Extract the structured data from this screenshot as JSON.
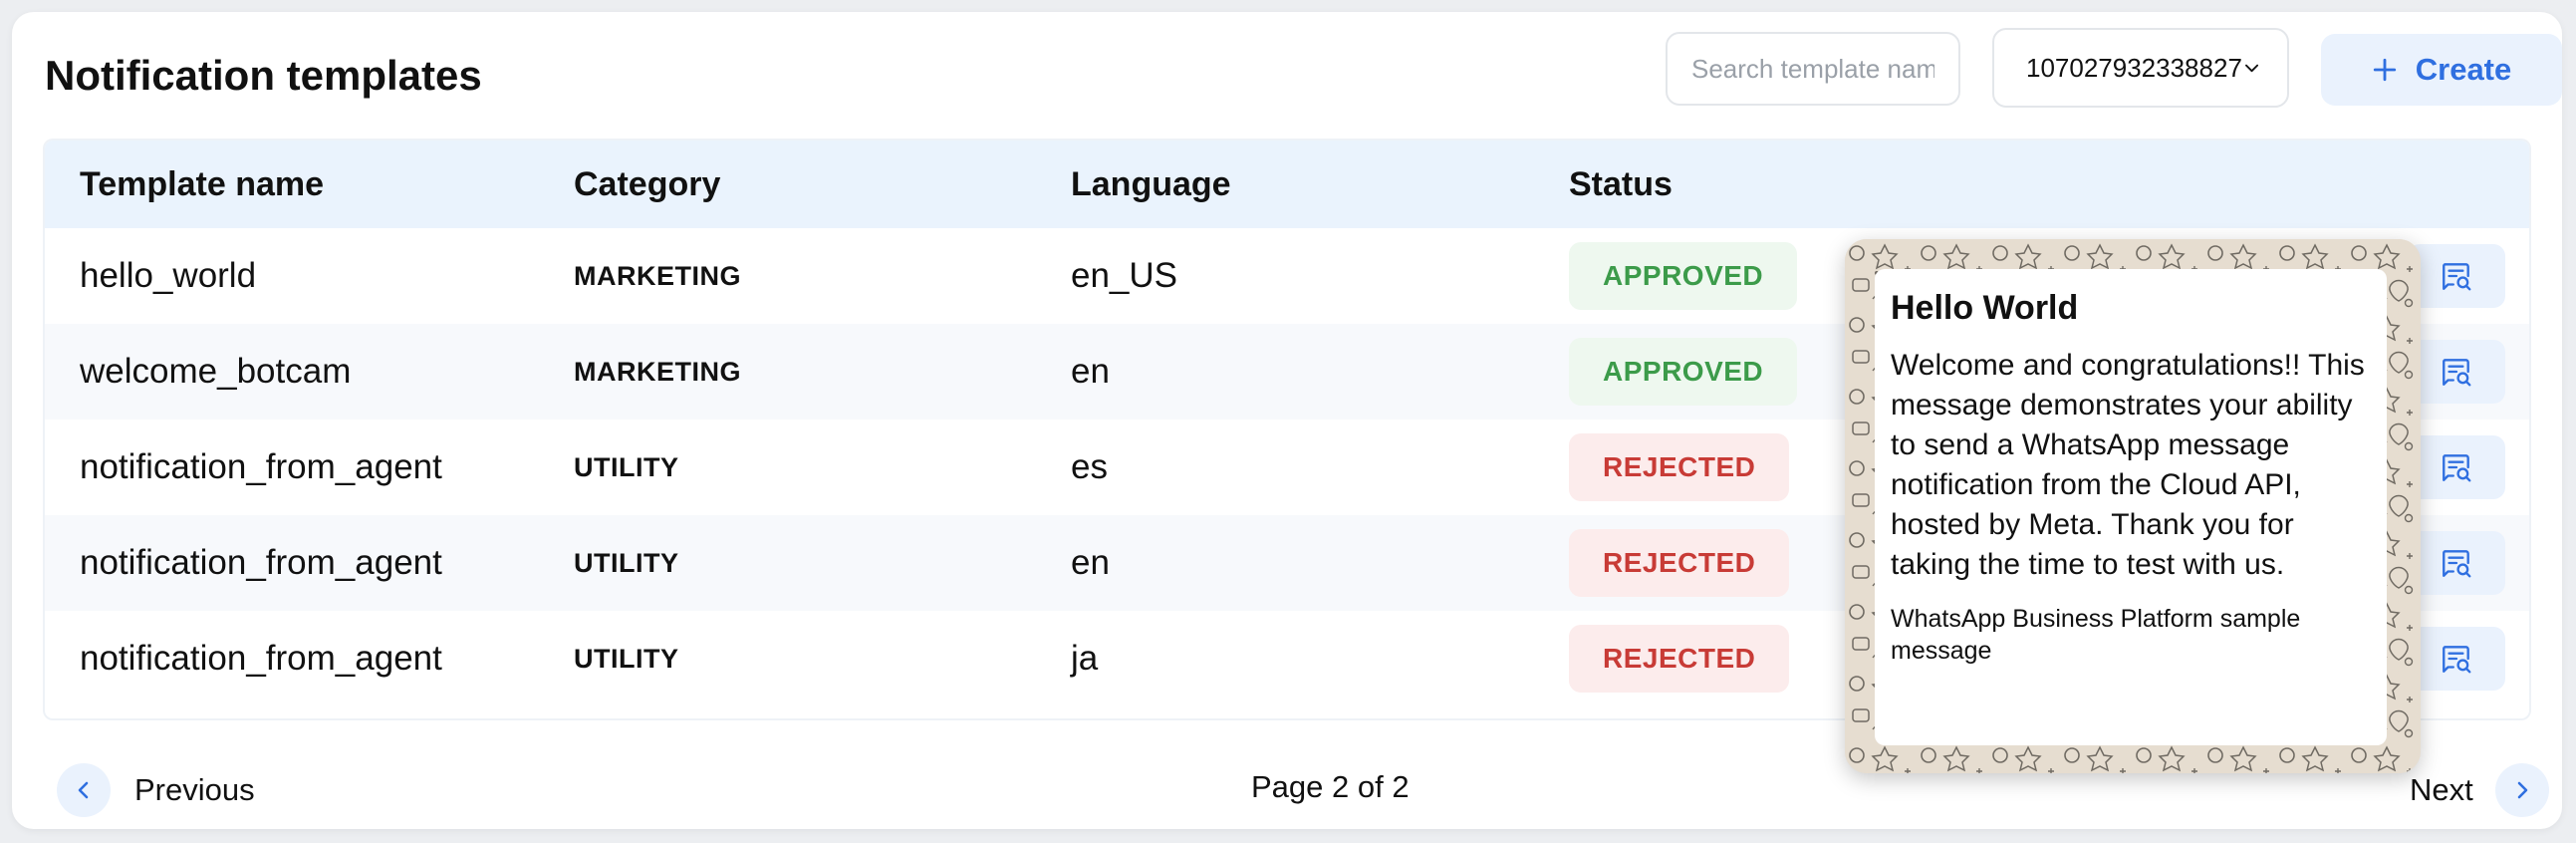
{
  "page": {
    "title": "Notification templates"
  },
  "toolbar": {
    "search_placeholder": "Search template name",
    "account_selected": "107027932338827",
    "create_label": "Create"
  },
  "table": {
    "columns": [
      "Template name",
      "Category",
      "Language",
      "Status"
    ],
    "rows": [
      {
        "name": "hello_world",
        "category": "MARKETING",
        "language": "en_US",
        "status": "APPROVED"
      },
      {
        "name": "welcome_botcam",
        "category": "MARKETING",
        "language": "en",
        "status": "APPROVED"
      },
      {
        "name": "notification_from_agent",
        "category": "UTILITY",
        "language": "es",
        "status": "REJECTED"
      },
      {
        "name": "notification_from_agent",
        "category": "UTILITY",
        "language": "en",
        "status": "REJECTED"
      },
      {
        "name": "notification_from_agent",
        "category": "UTILITY",
        "language": "ja",
        "status": "REJECTED"
      }
    ]
  },
  "pagination": {
    "previous_label": "Previous",
    "page_indicator": "Page 2 of 2",
    "next_label": "Next"
  },
  "preview": {
    "header": "Hello World",
    "body": "Welcome and congratulations!! This message demonstrates your ability to send a WhatsApp message notification from the Cloud API, hosted by Meta. Thank you for taking the time to test with us.",
    "footer": "WhatsApp Business Platform sample message"
  },
  "colors": {
    "accent": "#2f6fe0",
    "approved": "#3c9b4a",
    "rejected": "#c83b36",
    "header_bg": "#eaf3fd"
  },
  "icons": {
    "create": "plus-icon",
    "select": "chevron-down-icon",
    "preview": "message-search-icon",
    "prev": "chevron-left-icon",
    "next": "chevron-right-icon"
  }
}
